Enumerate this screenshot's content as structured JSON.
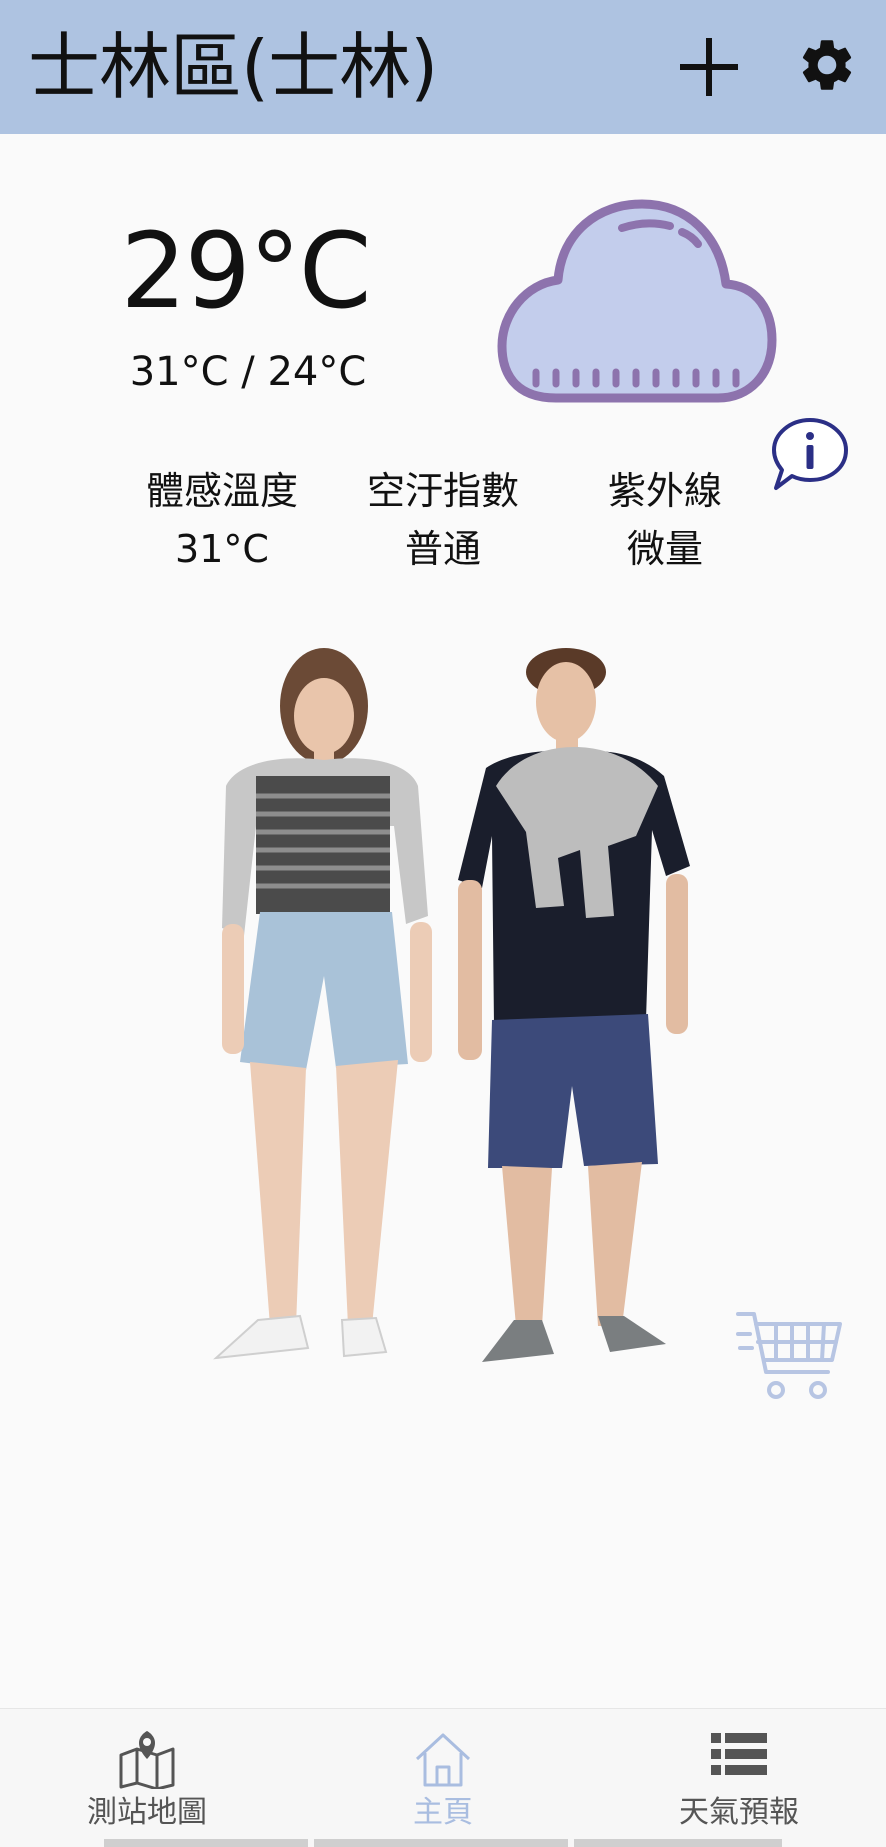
{
  "header": {
    "title": "士林區(士林)",
    "add_icon": "plus-icon",
    "settings_icon": "gear-icon",
    "color": "#aec3e1"
  },
  "weather": {
    "current_temp": "29°C",
    "range": "31°C / 24°C",
    "condition_icon": "cloud-icon",
    "info_icon": "info-speech-bubble-icon",
    "stats": [
      {
        "label": "體感溫度",
        "value": "31°C"
      },
      {
        "label": "空汙指數",
        "value": "普通"
      },
      {
        "label": "紫外線",
        "value": "微量"
      }
    ]
  },
  "outfit": {
    "cart_icon": "shopping-cart-icon"
  },
  "bottom_nav": {
    "items": [
      {
        "label": "測站地圖",
        "icon": "map-pin-icon",
        "active": false
      },
      {
        "label": "主頁",
        "icon": "home-icon",
        "active": true
      },
      {
        "label": "天氣預報",
        "icon": "list-icon",
        "active": false
      }
    ],
    "active_color": "#a9bde0"
  }
}
